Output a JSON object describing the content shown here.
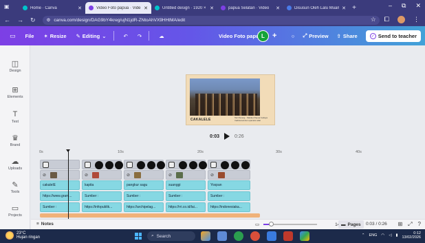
{
  "browser": {
    "tabs": [
      {
        "title": "Home · Canva",
        "favicon_color": "#00c4cc",
        "active": false
      },
      {
        "title": "Video Foto papua · Vide",
        "favicon_color": "#7d3fe5",
        "active": true
      },
      {
        "title": "Untitled design · 1920 ×",
        "favicon_color": "#00c4cc",
        "active": false
      },
      {
        "title": "papua Selatan · Video",
        "favicon_color": "#7d3fe5",
        "active": false
      },
      {
        "title": "Disusun Oleh Lalu Muam",
        "favicon_color": "#4a7be8",
        "active": false
      }
    ],
    "new_tab": "+",
    "url": "canva.com/design/DAG9bY4kreg/ujN1jdR-ZNtoAhVX9HHtMA/edit",
    "controls": {
      "minimize": "–",
      "maximize": "⧉",
      "close": "✕"
    }
  },
  "header": {
    "file": "File",
    "resize": "Resize",
    "editing": "Editing",
    "doc_title": "Video Foto papua",
    "avatar_initial": "L",
    "preview": "Preview",
    "share": "Share",
    "send_to_teacher": "Send to teacher",
    "colors": {
      "start": "#7d3fe5",
      "end": "#41a2d8"
    }
  },
  "sidebar": {
    "items": [
      {
        "label": "Design",
        "icon": "layout-icon"
      },
      {
        "label": "Elements",
        "icon": "shapes-icon"
      },
      {
        "label": "Text",
        "icon": "text-icon"
      },
      {
        "label": "Brand",
        "icon": "crown-icon"
      },
      {
        "label": "Uploads",
        "icon": "cloud-upload-icon"
      },
      {
        "label": "Tools",
        "icon": "draw-icon"
      },
      {
        "label": "Projects",
        "icon": "folder-icon"
      }
    ]
  },
  "canvas": {
    "title_text": "CAKALELE",
    "caption": "Tari Perang · Maluku Papua budaya tradisional dan upacara adat",
    "current_time": "0:03",
    "duration": "0:26"
  },
  "timeline": {
    "ruler": [
      "0s",
      "10s",
      "20s",
      "30s",
      "40s"
    ],
    "text_tracks": [
      [
        "cakalelE",
        "kapita",
        "pangkur sagu",
        "suanggi",
        "Yospan"
      ],
      [
        "https://www.gram...",
        "Sumber :",
        "Sumber :",
        "Sumber :",
        "Sumber :"
      ],
      [
        "Sumber :",
        "https://infopublik...",
        "https://archipelag...",
        "https://rri.co.id/lai...",
        "https://indonesiaka..."
      ]
    ]
  },
  "status": {
    "notes": "Notes",
    "zoom": "14%",
    "pages": "Pages",
    "time": "0:03 / 0:26"
  },
  "taskbar": {
    "temp": "23°C",
    "weather": "Hujan ringan",
    "search": "Search",
    "lang": "ENG",
    "time": "0:12",
    "date": "13/02/2026"
  }
}
